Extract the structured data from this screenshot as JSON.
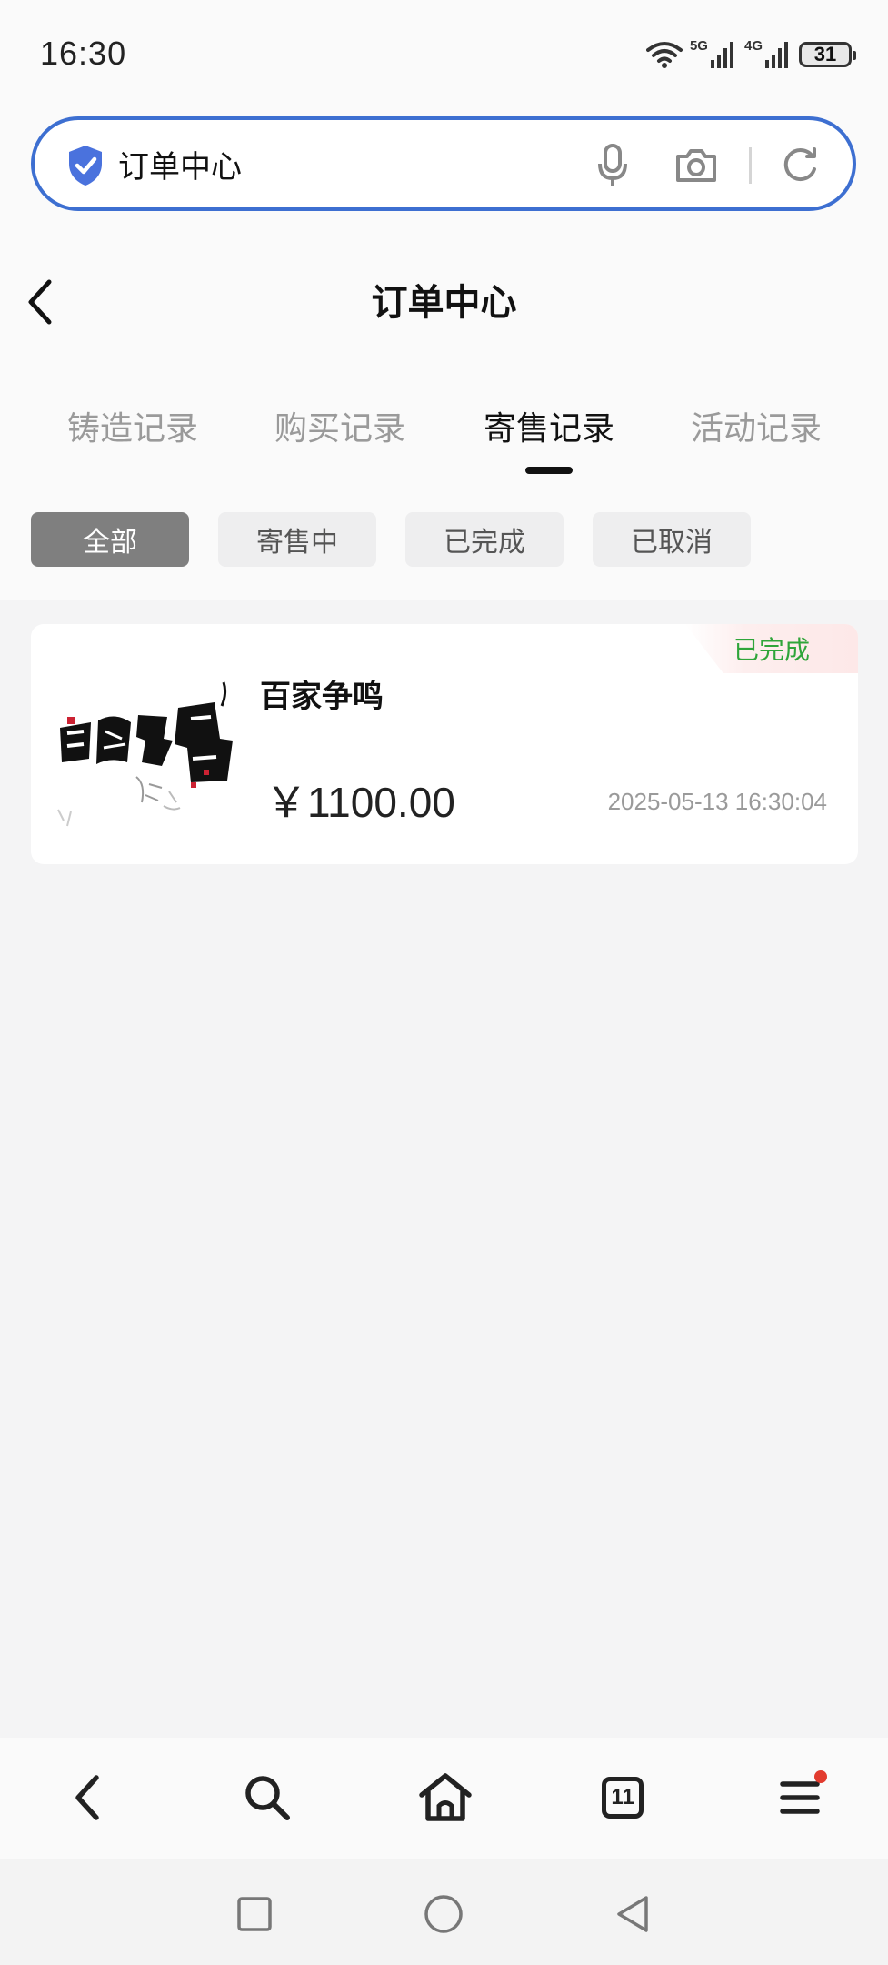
{
  "status_bar": {
    "time": "16:30",
    "net1": "5G",
    "net2": "4G",
    "battery": "31",
    "icons": [
      "wifi-icon",
      "signal-icon",
      "signal-icon",
      "battery-icon"
    ]
  },
  "address_bar": {
    "url_text": "订单中心",
    "icons": [
      "shield-check-icon",
      "microphone-icon",
      "camera-icon",
      "refresh-icon"
    ]
  },
  "header": {
    "title": "订单中心"
  },
  "tabs": [
    {
      "label": "铸造记录",
      "active": false
    },
    {
      "label": "购买记录",
      "active": false
    },
    {
      "label": "寄售记录",
      "active": true
    },
    {
      "label": "活动记录",
      "active": false
    }
  ],
  "filters": [
    {
      "label": "全部",
      "active": true
    },
    {
      "label": "寄售中",
      "active": false
    },
    {
      "label": "已完成",
      "active": false
    },
    {
      "label": "已取消",
      "active": false
    }
  ],
  "orders": [
    {
      "name": "百家争鸣",
      "price": "￥1100.00",
      "time": "2025-05-13 16:30:04",
      "status": "已完成",
      "status_color": "#2fa53a"
    }
  ],
  "toolbar": {
    "tab_count": "11",
    "icons": [
      "back-icon",
      "search-icon",
      "home-icon",
      "tabs-icon",
      "menu-icon"
    ]
  },
  "system_nav": {
    "icons": [
      "recent-apps-icon",
      "home-circle-icon",
      "back-triangle-icon"
    ]
  },
  "colors": {
    "accent_blue": "#3d6fd1",
    "status_green": "#2fa53a",
    "notify_red": "#e23b2e"
  }
}
